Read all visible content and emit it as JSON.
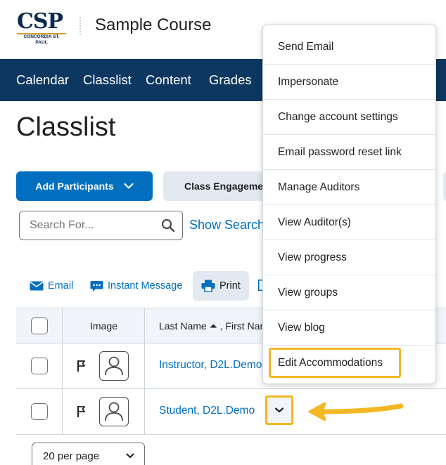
{
  "header": {
    "logo_text": "CSP",
    "logo_subtext": "CONCORDIA ST. PAUL",
    "course_title": "Sample Course"
  },
  "nav": {
    "items": [
      "Calendar",
      "Classlist",
      "Content",
      "Grades"
    ]
  },
  "page": {
    "title": "Classlist",
    "add_participants_label": "Add Participants",
    "class_engagement_label": "Class Engagement",
    "search_placeholder": "Search For...",
    "show_search_label": "Show Search"
  },
  "toolbar": {
    "email_label": "Email",
    "instant_message_label": "Instant Message",
    "print_label": "Print"
  },
  "table": {
    "headers": {
      "image": "Image",
      "name": "Last Name ⏶ , First Name"
    },
    "rows": [
      {
        "name": "Instructor, D2L.Demo"
      },
      {
        "name": "Student, D2L.Demo"
      }
    ]
  },
  "pagination": {
    "per_page_value": "20 per page"
  },
  "context_menu": {
    "items": [
      "Send Email",
      "Impersonate",
      "Change account settings",
      "Email password reset link",
      "Manage Auditors",
      "View Auditor(s)",
      "View progress",
      "View groups",
      "View blog",
      "Edit Accommodations"
    ],
    "highlighted_item": "Edit Accommodations"
  },
  "colors": {
    "nav_background": "#0c3760",
    "primary_button": "#006fbf",
    "link": "#006fbf",
    "highlight": "#f3b823"
  },
  "icons": [
    "search-icon",
    "chevron-down-icon",
    "email-icon",
    "chat-icon",
    "printer-icon",
    "flag-icon",
    "user-avatar-icon",
    "arrow-pointer-icon"
  ]
}
